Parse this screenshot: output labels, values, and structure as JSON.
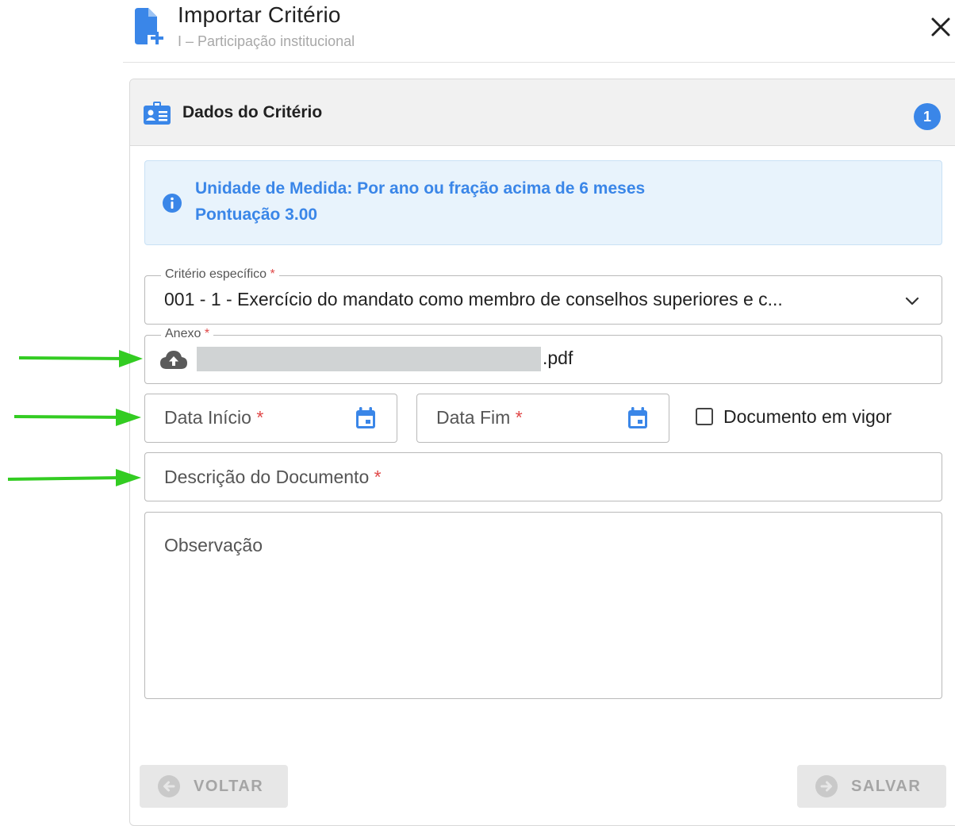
{
  "header": {
    "title": "Importar Critério",
    "subtitle": "I – Participação institucional",
    "close_icon": "close-icon"
  },
  "section": {
    "title": "Dados do Critério",
    "icon": "id-card-icon",
    "step_number": "1"
  },
  "info_alert": {
    "line1": "Unidade de Medida: Por ano ou fração acima de 6 meses",
    "line2": "Pontuação 3.00"
  },
  "form": {
    "required_mark": "*",
    "criterio": {
      "label": "Critério específico",
      "value": "001 - 1 - Exercício do mandato como membro de conselhos superiores e c..."
    },
    "anexo": {
      "label": "Anexo",
      "file_extension": ".pdf"
    },
    "data_inicio": {
      "placeholder": "Data Início"
    },
    "data_fim": {
      "placeholder": "Data Fim"
    },
    "documento_em_vigor": {
      "label": "Documento em vigor",
      "checked": false
    },
    "descricao": {
      "placeholder": "Descrição do Documento"
    },
    "observacao": {
      "placeholder": "Observação"
    }
  },
  "buttons": {
    "back_label": "VOLTAR",
    "save_label": "SALVAR"
  },
  "colors": {
    "primary": "#3a86e8",
    "alert_bg": "#e8f3fc",
    "required": "#e04848",
    "annotation_arrow": "#33cc22",
    "disabled_button": "#e7e7e7"
  }
}
